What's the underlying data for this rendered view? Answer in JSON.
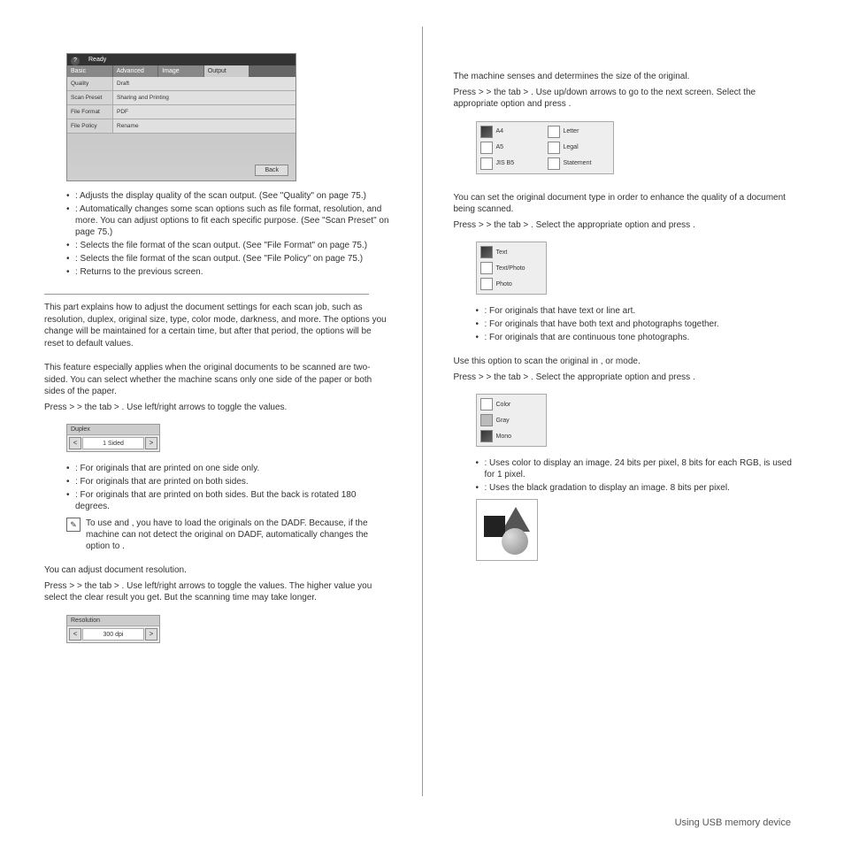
{
  "leftCol": {
    "screenshot": {
      "ready": "Ready",
      "tabs": [
        "Basic",
        "Advanced",
        "Image",
        "Output"
      ],
      "rows": [
        {
          "l": "Quality",
          "r": "Draft"
        },
        {
          "l": "Scan Preset",
          "r": "Sharing and Printing"
        },
        {
          "l": "File Format",
          "r": "PDF"
        },
        {
          "l": "File Policy",
          "r": "Rename"
        }
      ],
      "back": "Back"
    },
    "outputBullets": [
      ": Adjusts the display quality of the scan output. (See \"Quality\" on page 75.)",
      ": Automatically changes some scan options such as file format, resolution, and more. You can adjust options to fit each specific purpose. (See \"Scan Preset\" on page 75.)",
      ": Selects the file format of the scan output. (See \"File Format\" on page 75.)",
      ": Selects the file format of the scan output. (See \"File Policy\" on page 75.)",
      ": Returns to the previous screen."
    ],
    "explain": "This part explains how to adjust the document settings for each scan job, such as resolution, duplex, original size, type, color mode, darkness, and more. The options you change will be maintained for a certain time, but after that period, the options will be reset to default values.",
    "duplexIntro": "This feature especially applies when the original documents to be scanned are two-sided. You can select whether the machine scans only one side of the paper or both sides of the paper.",
    "duplexPress": "Press           >                         > the           tab >              . Use left/right arrows to toggle the values.",
    "duplexUI": {
      "hdr": "Duplex",
      "val": "1 Sided"
    },
    "duplexBullets": [
      ": For originals that are printed on one side only.",
      ": For originals that are printed on both sides.",
      ": For originals that are printed on both sides. But the back is rotated 180 degrees."
    ],
    "note": "To use            and                                        , you have to load the originals on the DADF. Because, if the machine can not detect the original on DADF, automatically changes the option to              .",
    "resIntro": "You can adjust document resolution.",
    "resPress": "Press           >                         > the           tab >                  . Use left/right arrows to toggle the values. The higher value you select the clear result you get. But the scanning time may take longer.",
    "resUI": {
      "hdr": "Resolution",
      "val": "300 dpi"
    }
  },
  "rightCol": {
    "sizeIntro": "The machine senses and determines the size of the original.",
    "sizePress": "Press           >                         > the                  tab >                       . Use up/down arrows to go to the next screen. Select the appropriate option and press        .",
    "sizeOpts": [
      [
        "A4",
        "Letter"
      ],
      [
        "A5",
        "Legal"
      ],
      [
        "JIS B5",
        "Statement"
      ]
    ],
    "typeIntro": "You can set the original document type in order to enhance the quality of a document being scanned.",
    "typePress": "Press           >                         > the           tab >                       . Select the appropriate option and press        .",
    "typeOpts": [
      "Text",
      "Text/Photo",
      "Photo"
    ],
    "typeBullets": [
      ": For originals that have text or line art.",
      ": For originals that have both text and photographs together.",
      ": For originals that are continuous tone photographs."
    ],
    "colorIntro": "Use this option to scan the original in          ,          or           mode.",
    "colorPress": "Press           >                         > the           tab >                    . Select the appropriate option and press        .",
    "colorOpts": [
      "Color",
      "Gray",
      "Mono"
    ],
    "colorBullets": [
      ": Uses color to display an image. 24 bits per pixel, 8 bits for each RGB, is used for 1 pixel.",
      ": Uses the black gradation to display an image. 8 bits per pixel."
    ]
  },
  "footer": "Using USB memory device"
}
